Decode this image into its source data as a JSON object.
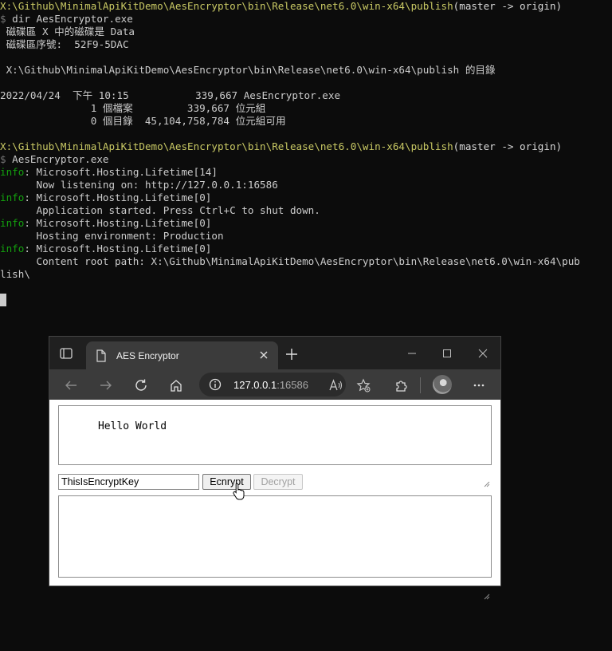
{
  "terminal": {
    "path1": "X:\\Github\\MinimalApiKitDemo\\AesEncryptor\\bin\\Release\\net6.0\\win-x64\\publish",
    "git1": "(master -> origin)",
    "prompt1": "$",
    "cmd1": " dir AesEncryptor.exe",
    "vol1": " 磁碟區 X 中的磁碟是 Data",
    "vol2": " 磁碟區序號:  52F9-5DAC",
    "dirof": " X:\\Github\\MinimalApiKitDemo\\AesEncryptor\\bin\\Release\\net6.0\\win-x64\\publish 的目錄",
    "file_line": "2022/04/24  下午 10:15           339,667 AesEncryptor.exe",
    "summary1": "               1 個檔案         339,667 位元組",
    "summary2": "               0 個目錄  45,104,758,784 位元組可用",
    "path2": "X:\\Github\\MinimalApiKitDemo\\AesEncryptor\\bin\\Release\\net6.0\\win-x64\\publish",
    "git2": "(master -> origin)",
    "prompt2": "$",
    "cmd2": " AesEncryptor.exe",
    "info_label": "info",
    "log1": ": Microsoft.Hosting.Lifetime[14]",
    "log1b": "      Now listening on: http://127.0.0.1:16586",
    "log2": ": Microsoft.Hosting.Lifetime[0]",
    "log2b": "      Application started. Press Ctrl+C to shut down.",
    "log3": ": Microsoft.Hosting.Lifetime[0]",
    "log3b": "      Hosting environment: Production",
    "log4": ": Microsoft.Hosting.Lifetime[0]",
    "log4b": "      Content root path: X:\\Github\\MinimalApiKitDemo\\AesEncryptor\\bin\\Release\\net6.0\\win-x64\\pub",
    "log4c": "lish\\"
  },
  "browser": {
    "tab_title": "AES Encryptor",
    "address_host": "127.0.0.1",
    "address_port": ":16586",
    "icons": [
      "tab-actions-icon",
      "page-icon",
      "close-icon",
      "plus-icon",
      "minimize-icon",
      "maximize-icon",
      "window-close-icon",
      "back-icon",
      "forward-icon",
      "refresh-icon",
      "home-icon",
      "info-icon",
      "read-aloud-icon",
      "favorites-icon",
      "extensions-icon",
      "more-icon"
    ]
  },
  "page": {
    "plaintext": "Hello World",
    "key": "ThisIsEncryptKey",
    "encrypt_label": "Ecnrypt",
    "decrypt_label": "Decrypt",
    "output": ""
  }
}
